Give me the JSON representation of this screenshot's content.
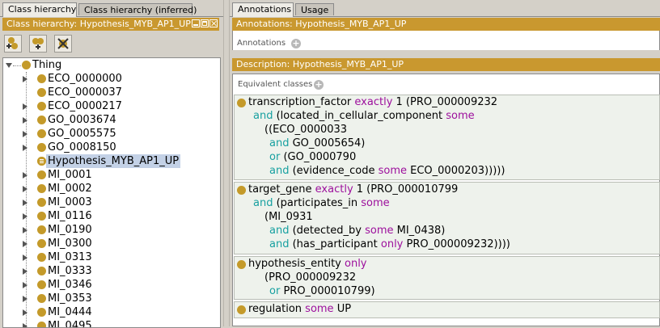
{
  "left_tabs": [
    {
      "label": "Class hierarchy",
      "active": true
    },
    {
      "label": "Class hierarchy (inferred)",
      "active": false
    }
  ],
  "left_header": "Class hierarchy: Hypothesis_MYB_AP1_UP",
  "tree": {
    "root": "Thing",
    "items": [
      "ECO_0000000",
      "ECO_0000037",
      "ECO_0000217",
      "GO_0003674",
      "GO_0005575",
      "GO_0008150",
      "Hypothesis_MYB_AP1_UP",
      "MI_0001",
      "MI_0002",
      "MI_0003",
      "MI_0116",
      "MI_0190",
      "MI_0300",
      "MI_0313",
      "MI_0333",
      "MI_0346",
      "MI_0353",
      "MI_0444",
      "MI_0495"
    ],
    "selected": "Hypothesis_MYB_AP1_UP"
  },
  "right_tabs": [
    {
      "label": "Annotations",
      "active": true
    },
    {
      "label": "Usage",
      "active": false
    }
  ],
  "annotations_header": "Annotations: Hypothesis_MYB_AP1_UP",
  "annotations_label": "Annotations",
  "description_header": "Description: Hypothesis_MYB_AP1_UP",
  "equivalent_label": "Equivalent classes",
  "colors": {
    "gold": "#c9982f",
    "keyword": "#9d109d",
    "operator": "#17a0a0",
    "selection": "#c3d1e6"
  }
}
